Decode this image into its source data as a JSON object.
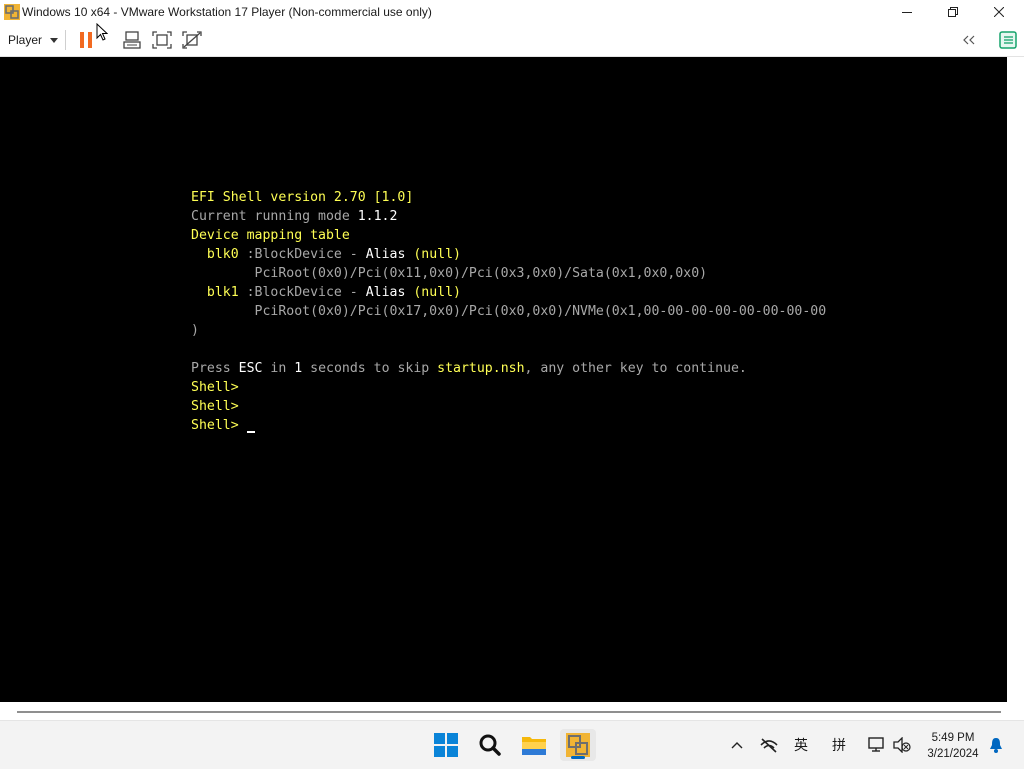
{
  "window": {
    "title": "Windows 10 x64 - VMware Workstation 17 Player (Non-commercial use only)",
    "controls": [
      "minimize",
      "maximize",
      "close"
    ]
  },
  "toolbar": {
    "player_label": "Player",
    "buttons": [
      "pause-icon",
      "send-ctrl-alt-del-icon",
      "fullscreen-icon",
      "unity-icon",
      "collapse-icon",
      "library-icon"
    ]
  },
  "console": {
    "lines": [
      [
        {
          "t": "EFI Shell version 2.70 [1.0]",
          "c": "y"
        }
      ],
      [
        {
          "t": "Current running mode ",
          "c": "g"
        },
        {
          "t": "1.1.2",
          "c": "w"
        }
      ],
      [
        {
          "t": "Device mapping table",
          "c": "y"
        }
      ],
      [
        {
          "t": "  ",
          "c": "g"
        },
        {
          "t": "blk0",
          "c": "y"
        },
        {
          "t": " :BlockDevice - ",
          "c": "g"
        },
        {
          "t": "Alias",
          "c": "w"
        },
        {
          "t": " (null)",
          "c": "y"
        }
      ],
      [
        {
          "t": "        PciRoot(0x0)/Pci(0x11,0x0)/Pci(0x3,0x0)/Sata(0x1,0x0,0x0)",
          "c": "g"
        }
      ],
      [
        {
          "t": "  ",
          "c": "g"
        },
        {
          "t": "blk1",
          "c": "y"
        },
        {
          "t": " :BlockDevice - ",
          "c": "g"
        },
        {
          "t": "Alias",
          "c": "w"
        },
        {
          "t": " (null)",
          "c": "y"
        }
      ],
      [
        {
          "t": "        PciRoot(0x0)/Pci(0x17,0x0)/Pci(0x0,0x0)/NVMe(0x1,00-00-00-00-00-00-00-00",
          "c": "g"
        }
      ],
      [
        {
          "t": ")",
          "c": "g"
        }
      ],
      [
        {
          "t": "",
          "c": "g"
        }
      ],
      [
        {
          "t": "Press ",
          "c": "g"
        },
        {
          "t": "ESC",
          "c": "w"
        },
        {
          "t": " in ",
          "c": "g"
        },
        {
          "t": "1",
          "c": "w"
        },
        {
          "t": " seconds to skip ",
          "c": "g"
        },
        {
          "t": "startup.nsh",
          "c": "y"
        },
        {
          "t": ", any other key to continue.",
          "c": "g"
        }
      ],
      [
        {
          "t": "Shell> ",
          "c": "y"
        }
      ],
      [
        {
          "t": "Shell> ",
          "c": "y"
        }
      ],
      [
        {
          "t": "Shell> ",
          "c": "y"
        }
      ]
    ]
  },
  "taskbar": {
    "apps": [
      "windows-start-icon",
      "search-icon",
      "file-explorer-icon",
      "vmware-player-icon"
    ],
    "tray": {
      "chevron": "^",
      "ime_lang": "英",
      "ime_mode": "拼",
      "time": "5:49 PM",
      "date": "3/21/2024"
    }
  },
  "colors": {
    "console_yellow": "#ffff54",
    "console_white": "#ffffff",
    "console_gray": "#a8a8a8",
    "accent": "#0067c0"
  }
}
